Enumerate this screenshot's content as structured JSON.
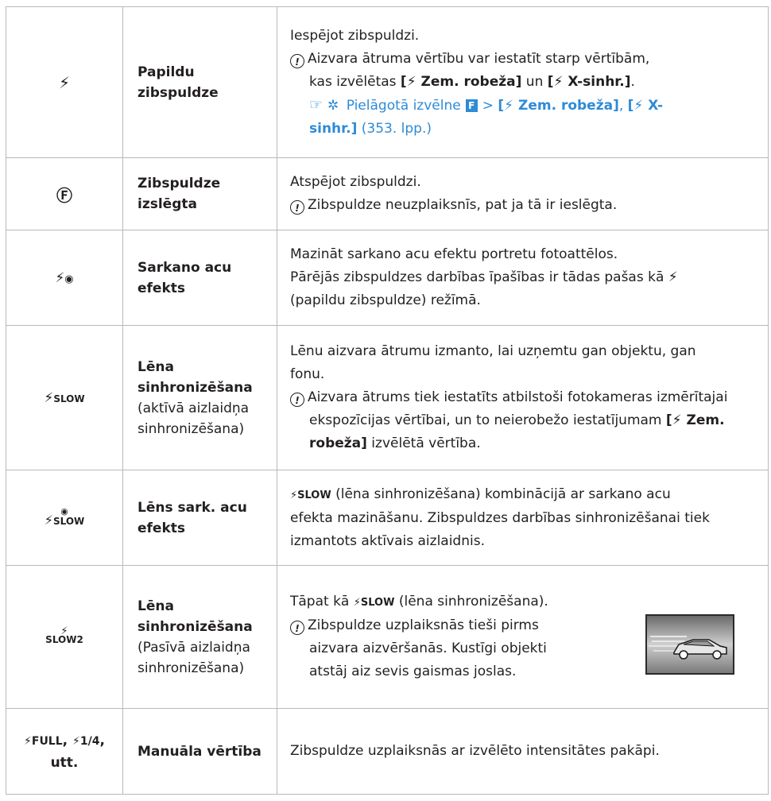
{
  "rows": [
    {
      "symbol": "⚡",
      "name": "Papildu zibspuldze",
      "name_line1": "Papildu",
      "name_line2": "zibspuldze",
      "desc_line1": "Iespējot zibspuldzi.",
      "note_line1": "Aizvara ātruma vērtību var iestatīt starp vērtībām,",
      "note_line2_pre": "kas izvēlētas ",
      "note_line2_b1": "[⚡ Zem. robeža]",
      "note_line2_mid": " un ",
      "note_line2_b2": "[⚡ X-sinhr.]",
      "note_line2_post": ".",
      "ref_text1": "Pielāgotā izvēlne",
      "ref_badge": "F",
      "ref_gt": ">",
      "ref_b1": "[⚡ Zem. robeža]",
      "ref_comma": ",",
      "ref_b2a": "[⚡ X-",
      "ref_b2b": "sinhr.]",
      "ref_page": "(353. lpp.)"
    },
    {
      "symbol": "Ⓕ",
      "name_line1": "Zibspuldze",
      "name_line2": "izslēgta",
      "desc_line1": "Atspējot zibspuldzi.",
      "note_line1": "Zibspuldze neuzplaiksnīs, pat ja tā ir ieslēgta."
    },
    {
      "symbol_a": "⚡",
      "symbol_b": "◉",
      "name_line1": "Sarkano acu",
      "name_line2": "efekts",
      "desc_line1": "Mazināt sarkano acu efektu portretu fotoattēlos.",
      "desc_line2": "Pārējās zibspuldzes darbības īpašības ir tādas pašas kā ⚡",
      "desc_line3": "(papildu zibspuldze) režīmā."
    },
    {
      "symbol_bolt": "⚡",
      "symbol_text": "SLOW",
      "name_line1": "Lēna",
      "name_line2": "sinhronizēšana",
      "name_sub1": "(aktīvā aizlaidņa",
      "name_sub2": "sinhronizēšana)",
      "desc_line1": "Lēnu aizvara ātrumu izmanto, lai uzņemtu gan objektu, gan",
      "desc_line2": "fonu.",
      "note_line1": "Aizvara ātrums tiek iestatīts atbilstoši fotokameras izmērītajai",
      "note_line2_pre": "ekspozīcijas vērtībai, un to neierobežo iestatījumam ",
      "note_line2_b": "[⚡ Zem.",
      "note_line3_b": "robeža]",
      "note_line3_post": " izvēlētā vērtība."
    },
    {
      "symbol_bolt": "⚡",
      "symbol_eye": "◉",
      "symbol_text": "SLOW",
      "name_line1": "Lēns sark. acu",
      "name_line2": "efekts",
      "desc_sym": "⚡SLOW",
      "desc_line1": " (lēna sinhronizēšana) kombinācijā ar sarkano acu",
      "desc_line2": "efekta mazināšanu. Zibspuldzes darbības sinhronizēšanai tiek",
      "desc_line3": "izmantots aktīvais aizlaidnis."
    },
    {
      "symbol_bolt": "⚡",
      "symbol_text": "SLOW2",
      "name_line1": "Lēna",
      "name_line2": "sinhronizēšana",
      "name_sub1": "(Pasīvā aizlaidņa",
      "name_sub2": "sinhronizēšana)",
      "desc_pre": "Tāpat kā ",
      "desc_sym": "⚡SLOW",
      "desc_post": " (lēna sinhronizēšana).",
      "note_line1": "Zibspuldze uzplaiksnās tieši pirms",
      "note_line2": "aizvara aizvēršanās. Kustīgi objekti",
      "note_line3": "atstāj aiz sevis gaismas joslas."
    },
    {
      "symbol_line1_a": "⚡FULL",
      "symbol_sep": ", ",
      "symbol_line1_b": "⚡1/4",
      "symbol_comma": ",",
      "symbol_line2": "utt.",
      "name": "Manuāla vērtība",
      "desc_line1": "Zibspuldze uzplaiksnās ar izvēlēto intensitātes pakāpi."
    }
  ],
  "colors": {
    "link": "#2e8bd6",
    "border": "#b7b9bc",
    "text": "#231f20"
  },
  "icons": {
    "note": "note-icon",
    "ref": "reference-pointing-hand-icon",
    "gear": "gear-icon",
    "badge": "f-badge-icon"
  }
}
